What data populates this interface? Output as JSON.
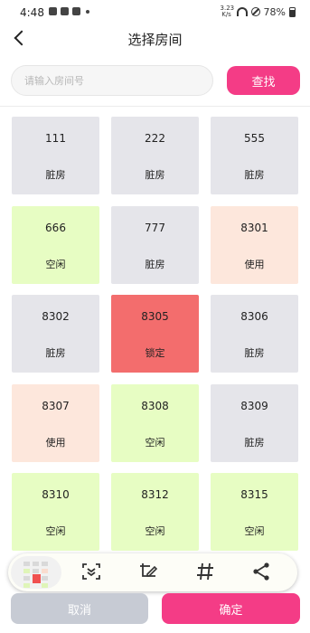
{
  "status_bar": {
    "time": "4:48",
    "net_speed_value": "3.23",
    "net_speed_unit": "K/s",
    "battery": "78%"
  },
  "header": {
    "title": "选择房间"
  },
  "search": {
    "placeholder": "请输入房间号",
    "value": "",
    "button_label": "查找"
  },
  "status_colors": {
    "脏房": "#e5e5ea",
    "空闲": "#e7fdc3",
    "使用": "#fde7dc",
    "锁定": "#f36d6d"
  },
  "rooms": [
    {
      "number": "111",
      "status": "脏房"
    },
    {
      "number": "222",
      "status": "脏房"
    },
    {
      "number": "555",
      "status": "脏房"
    },
    {
      "number": "666",
      "status": "空闲"
    },
    {
      "number": "777",
      "status": "脏房"
    },
    {
      "number": "8301",
      "status": "使用"
    },
    {
      "number": "8302",
      "status": "脏房"
    },
    {
      "number": "8305",
      "status": "锁定"
    },
    {
      "number": "8306",
      "status": "脏房"
    },
    {
      "number": "8307",
      "status": "使用"
    },
    {
      "number": "8308",
      "status": "空闲"
    },
    {
      "number": "8309",
      "status": "脏房"
    },
    {
      "number": "8310",
      "status": "空闲"
    },
    {
      "number": "8312",
      "status": "空闲"
    },
    {
      "number": "8315",
      "status": "空闲"
    }
  ],
  "toolbar": {
    "icons": [
      "screenshot-thumbnail",
      "scroll-capture-icon",
      "edit-crop-icon",
      "hashtag-icon",
      "share-icon"
    ]
  },
  "actions": {
    "cancel_label": "取消",
    "confirm_label": "确定"
  }
}
